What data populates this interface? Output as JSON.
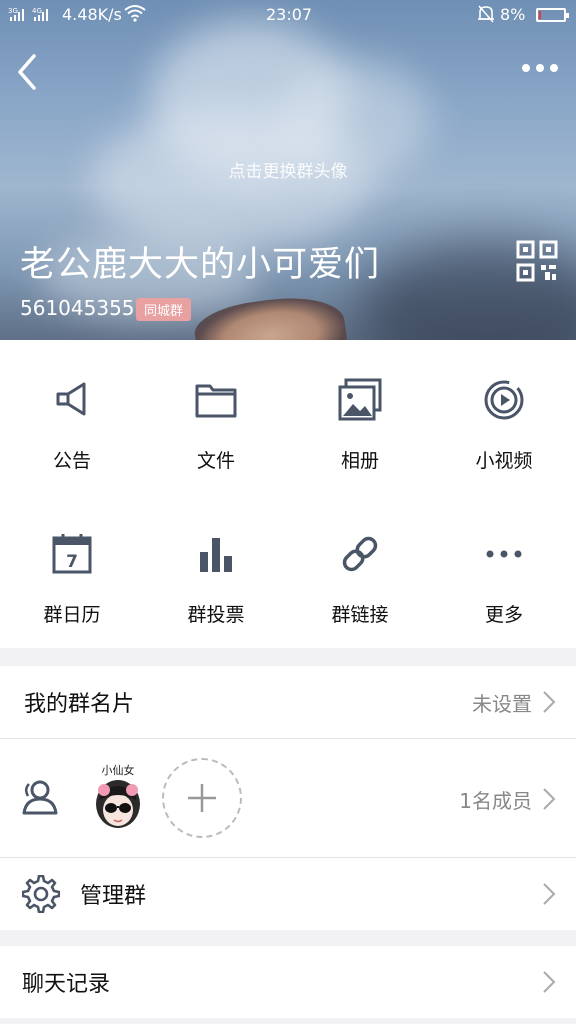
{
  "status_bar": {
    "signal": "3G",
    "speed": "4.48K/s",
    "time": "23:07",
    "battery_pct": "8%",
    "battery_level": 0.08,
    "battery_color": "#e23b3b"
  },
  "header": {
    "change_avatar_hint": "点击更换群头像",
    "group_name": "老公鹿大大的小可爱们",
    "group_id": "561045355",
    "city_badge": "同城群"
  },
  "grid": {
    "items": [
      {
        "label": "公告",
        "icon": "megaphone-icon"
      },
      {
        "label": "文件",
        "icon": "folder-icon"
      },
      {
        "label": "相册",
        "icon": "album-icon"
      },
      {
        "label": "小视频",
        "icon": "video-icon"
      },
      {
        "label": "群日历",
        "icon": "calendar-icon"
      },
      {
        "label": "群投票",
        "icon": "vote-chart-icon"
      },
      {
        "label": "群链接",
        "icon": "link-icon"
      },
      {
        "label": "更多",
        "icon": "more-dots-icon"
      }
    ],
    "calendar_day": "7"
  },
  "rows": {
    "card_label": "我的群名片",
    "card_value": "未设置",
    "members_count": "1名成员",
    "avatar_text": "小仙女",
    "manage_label": "管理群",
    "chat_history_label": "聊天记录"
  },
  "colors": {
    "icon_gray": "#4a5568",
    "badge_pink": "#e9a0a0"
  }
}
